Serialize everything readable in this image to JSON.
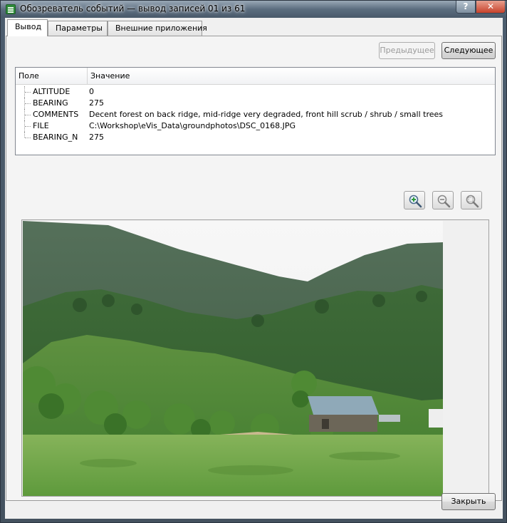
{
  "window": {
    "title": "Обозреватель событий — вывод записей 01 из 61",
    "help_label": "?",
    "close_label": "✕"
  },
  "tabs": [
    {
      "label": "Вывод",
      "active": true
    },
    {
      "label": "Параметры",
      "active": false
    },
    {
      "label": "Внешние приложения",
      "active": false
    }
  ],
  "nav": {
    "prev_label": "Предыдущее",
    "next_label": "Следующее"
  },
  "table": {
    "headers": [
      "Поле",
      "Значение"
    ],
    "rows": [
      {
        "field": "ALTITUDE",
        "value": "0"
      },
      {
        "field": "BEARING",
        "value": "275"
      },
      {
        "field": "COMMENTS",
        "value": "Decent forest on back ridge, mid-ridge very degraded, front hill scrub / shrub / small trees"
      },
      {
        "field": "FILE",
        "value": "C:\\Workshop\\eVis_Data\\groundphotos\\DSC_0168.JPG"
      },
      {
        "field": "BEARING_N",
        "value": "275"
      }
    ]
  },
  "zoom_tools": [
    {
      "name": "zoom-in-icon"
    },
    {
      "name": "zoom-out-icon"
    },
    {
      "name": "zoom-full-icon"
    }
  ],
  "footer": {
    "close_label": "Закрыть"
  },
  "colors": {
    "title_bar": "#5b6d7f",
    "panel_bg": "#f0f0f0",
    "sky": "#f4f4f4",
    "forest_dark": "#2f4a32",
    "grass": "#6fa54a"
  }
}
